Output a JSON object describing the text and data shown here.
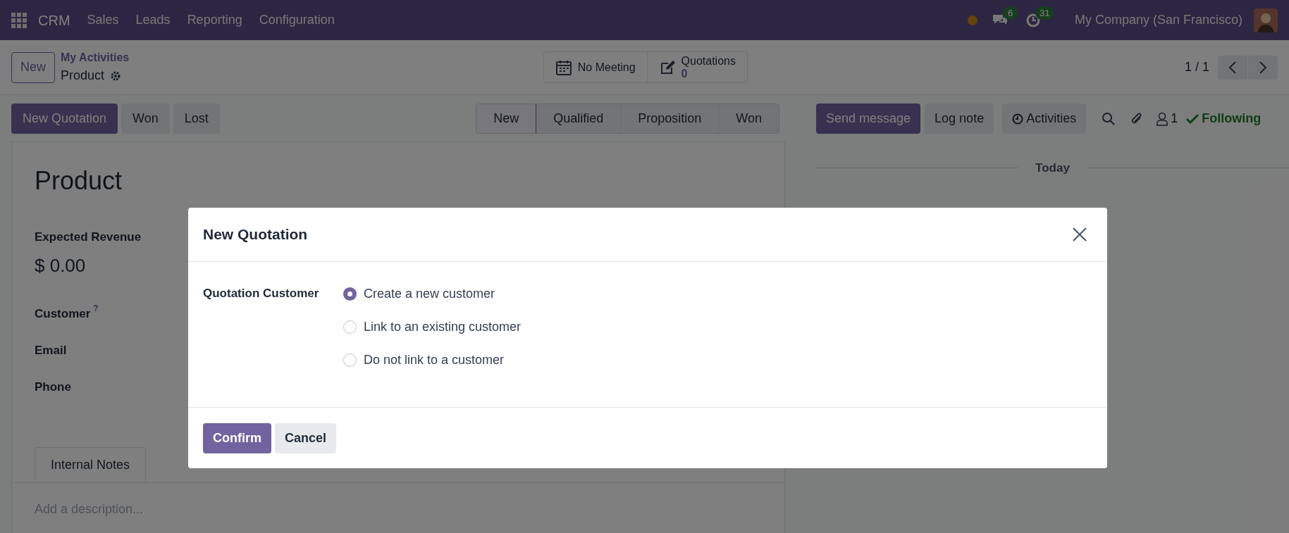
{
  "navbar": {
    "app_name": "CRM",
    "menu": [
      "Sales",
      "Leads",
      "Reporting",
      "Configuration"
    ],
    "messages_count": "6",
    "activities_count": "31",
    "company": "My Company (San Francisco)"
  },
  "control_panel": {
    "new_button": "New",
    "breadcrumb": "My Activities",
    "title": "Product",
    "smart_buttons": [
      {
        "kind": "calendar",
        "label": "No Meeting"
      },
      {
        "kind": "quotations",
        "label": "Quotations",
        "value": "0"
      }
    ],
    "pager": "1 / 1"
  },
  "actions": [
    {
      "label": "New Quotation",
      "kind": "primary"
    },
    {
      "label": "Won",
      "kind": "secondary"
    },
    {
      "label": "Lost",
      "kind": "secondary"
    }
  ],
  "stages": [
    {
      "label": "New",
      "selected": true
    },
    {
      "label": "Qualified",
      "selected": false
    },
    {
      "label": "Proposition",
      "selected": false
    },
    {
      "label": "Won",
      "selected": false
    }
  ],
  "chatter": {
    "buttons": [
      {
        "label": "Send message",
        "kind": "primary"
      },
      {
        "label": "Log note",
        "kind": "secondary"
      },
      {
        "label": "Activities",
        "kind": "activities"
      }
    ],
    "followers_count": "1",
    "following": "Following",
    "date_separator": "Today"
  },
  "form": {
    "title": "Product",
    "revenue_label": "Expected Revenue",
    "revenue_value": "$ 0.00",
    "fields": [
      {
        "label": "Customer",
        "help": "?"
      },
      {
        "label": "Email"
      },
      {
        "label": "Phone"
      }
    ],
    "tabs": [
      {
        "label": "Internal Notes",
        "selected": true
      }
    ],
    "description_placeholder": "Add a description..."
  },
  "dialog": {
    "title": "New Quotation",
    "field_label": "Quotation Customer",
    "options": [
      {
        "label": "Create a new customer",
        "selected": true
      },
      {
        "label": "Link to an existing customer",
        "selected": false
      },
      {
        "label": "Do not link to a customer",
        "selected": false
      }
    ],
    "buttons": [
      {
        "label": "Confirm",
        "kind": "primary"
      },
      {
        "label": "Cancel",
        "kind": "secondary"
      }
    ]
  }
}
